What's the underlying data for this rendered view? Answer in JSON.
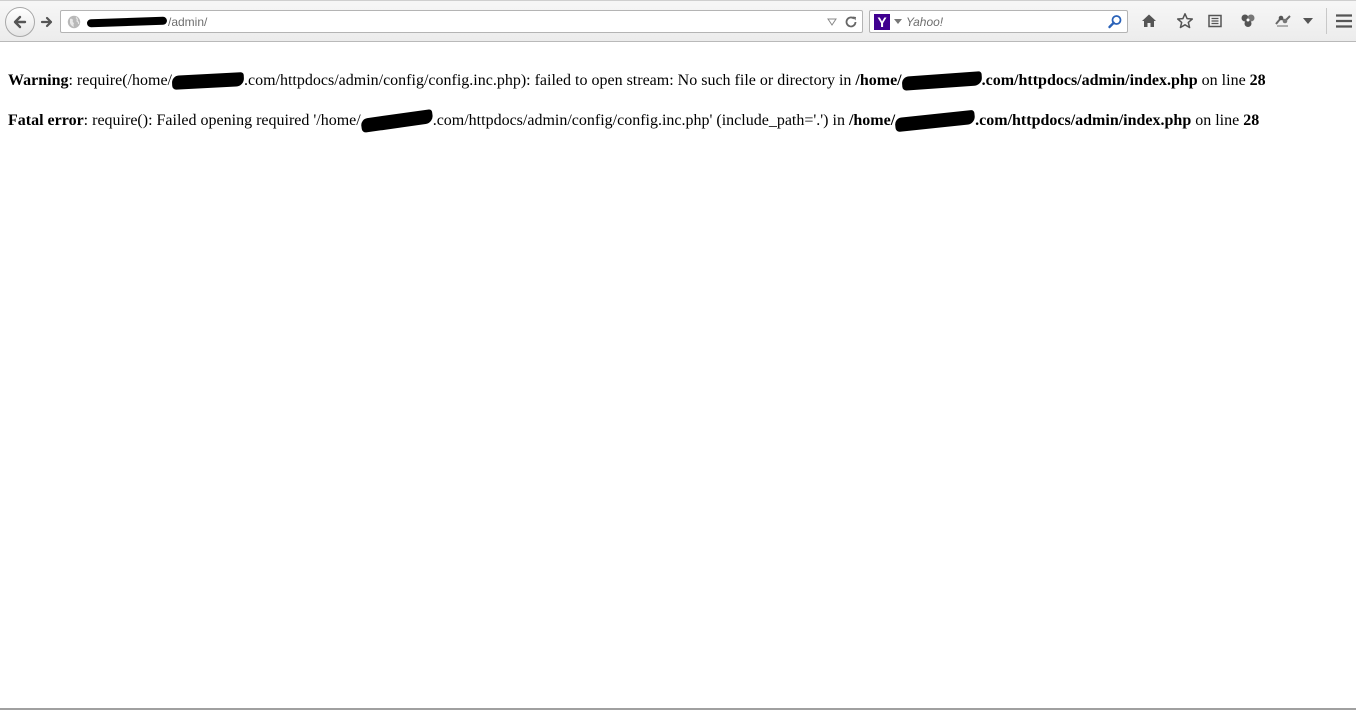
{
  "browser": {
    "url_path": "/admin/",
    "search_placeholder": "Yahoo!",
    "search_engine_letter": "Y",
    "search_engine_color": "#400090"
  },
  "errors": [
    {
      "label": "Warning",
      "text_1": ": require(/home/",
      "text_2": ".com/httpdocs/admin/config/config.inc.php): failed to open stream: No such file or directory in ",
      "file_prefix": "/home/",
      "file_suffix": ".com/httpdocs/admin/index.php",
      "line_text": " on line ",
      "line_number": "28"
    },
    {
      "label": "Fatal error",
      "text_1": ": require(): Failed opening required '/home/",
      "text_2": ".com/httpdocs/admin/config/config.inc.php' (include_path='.') in ",
      "file_prefix": "/home/",
      "file_suffix": ".com/httpdocs/admin/index.php",
      "line_text": " on line ",
      "line_number": "28"
    }
  ],
  "icons": {
    "back": "back-arrow-icon",
    "forward": "forward-arrow-icon",
    "site": "globe-icon",
    "reload": "reload-icon",
    "search": "magnifier-icon",
    "home": "home-icon",
    "bookmark": "star-icon",
    "reading_list": "reading-list-icon",
    "addon": "addon-icon",
    "extension": "extension-icon",
    "menu": "hamburger-menu-icon"
  }
}
